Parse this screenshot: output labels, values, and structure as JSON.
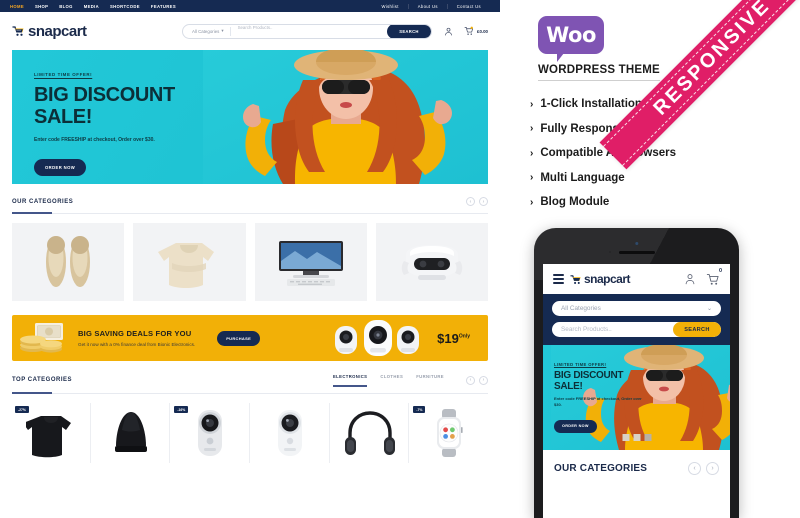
{
  "desktop": {
    "topbar": {
      "nav": [
        {
          "label": "HOME",
          "active": true
        },
        {
          "label": "SHOP",
          "active": false
        },
        {
          "label": "BLOG",
          "active": false
        },
        {
          "label": "MEDIA",
          "active": false
        },
        {
          "label": "SHORTCODE",
          "active": false
        },
        {
          "label": "FEATURES",
          "active": false
        }
      ],
      "links": [
        "Wishlist",
        "About Us",
        "Contact Us"
      ]
    },
    "header": {
      "logo_text": "snapcart",
      "category_select": "All Categories",
      "search_placeholder": "Search Products..",
      "search_button": "SEARCH",
      "cart_amount": "£0.00"
    },
    "hero": {
      "kicker": "LIMITED TIME OFFER!",
      "title_line1": "BIG DISCOUNT",
      "title_line2": "SALE!",
      "subtitle": "Enter code FREESHIP at checkout, Order over $30.",
      "button": "ORDER NOW"
    },
    "categories_section": {
      "title": "OUR CATEGORIES",
      "prev": "‹",
      "next": "›",
      "cards": [
        "flat-shoes",
        "lace-sweater",
        "desktop-monitor",
        "vr-headset"
      ]
    },
    "promo": {
      "title": "BIG SAVING DEALS FOR YOU",
      "subtitle": "Get it now with a 0% finance deal from Bionic Electronics.",
      "button": "PURCHASE",
      "price": "$19",
      "price_suffix": "Only"
    },
    "top_categories": {
      "title": "TOP CATEGORIES",
      "tabs": [
        {
          "label": "ELECTRONICS",
          "active": true
        },
        {
          "label": "CLOTHES",
          "active": false
        },
        {
          "label": "FURNITURE",
          "active": false
        }
      ],
      "prev": "‹",
      "next": "›",
      "products": [
        {
          "name": "black-sweatshirt",
          "badge": "-27%"
        },
        {
          "name": "bluetooth-speaker",
          "badge": ""
        },
        {
          "name": "action-camera",
          "badge": "-16%"
        },
        {
          "name": "security-camera",
          "badge": ""
        },
        {
          "name": "headphones",
          "badge": ""
        },
        {
          "name": "smart-watch",
          "badge": "-7%"
        }
      ]
    }
  },
  "info_panel": {
    "woo_logo_text": "Woo",
    "heading": "WORDPRESS THEME",
    "ribbon": "RESPONSIVE",
    "features": [
      "1-Click Installation",
      "Fully Responsive",
      "Compatible All Browsers",
      "Multi Language",
      "Blog Module"
    ],
    "chevron": "›"
  },
  "phone": {
    "logo_text": "snapcart",
    "cart_count": "0",
    "category_select": "All Categories",
    "search_placeholder": "Search Products..",
    "search_button": "SEARCH",
    "hero": {
      "kicker": "LIMITED TIME OFFER!",
      "title_line1": "BIG DISCOUNT",
      "title_line2": "SALE!",
      "subtitle": "Enter code FREESHIP at checkout, Order over $30.",
      "button": "ORDER NOW"
    },
    "section_title": "OUR CATEGORIES",
    "prev": "‹",
    "next": "›"
  },
  "colors": {
    "navy": "#152a52",
    "teal": "#22c8d8",
    "yellow": "#f2b007",
    "woo_purple": "#7f54b3",
    "ribbon_pink": "#e01e67"
  }
}
